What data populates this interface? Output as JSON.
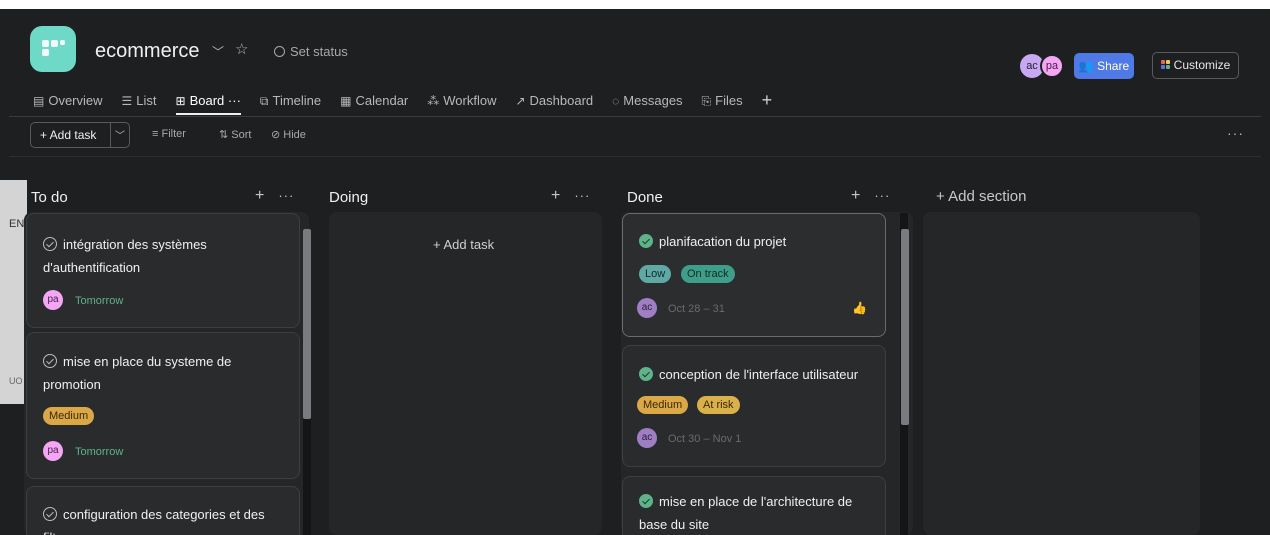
{
  "header": {
    "project_title": "ecommerce",
    "set_status": "Set status",
    "avatars": [
      "ac",
      "pa"
    ],
    "share_label": "Share",
    "customize_label": "Customize"
  },
  "tabs": [
    {
      "icon": "▤",
      "label": "Overview"
    },
    {
      "icon": "☰",
      "label": "List"
    },
    {
      "icon": "⊞",
      "label": "Board",
      "active": true,
      "extra": "···"
    },
    {
      "icon": "⧉",
      "label": "Timeline"
    },
    {
      "icon": "▦",
      "label": "Calendar"
    },
    {
      "icon": "⁂",
      "label": "Workflow"
    },
    {
      "icon": "↗",
      "label": "Dashboard"
    },
    {
      "icon": "◌",
      "label": "Messages"
    },
    {
      "icon": "⎘",
      "label": "Files"
    }
  ],
  "toolbar": {
    "add_task": "+ Add task",
    "filter": "Filter",
    "sort": "Sort",
    "hide": "Hide",
    "more": "···"
  },
  "left_strip": {
    "top_text": "EN",
    "bottom_text": "UO"
  },
  "columns": {
    "todo": {
      "title": "To do",
      "cards": [
        {
          "title": "intégration des systèmes d'authentification",
          "assignee": "pa",
          "due": "Tomorrow"
        },
        {
          "title": "mise en place du systeme de promotion",
          "priority": "Medium",
          "assignee": "pa",
          "due": "Tomorrow"
        },
        {
          "title": "configuration des categories et des filtres"
        }
      ]
    },
    "doing": {
      "title": "Doing",
      "add_task": "+ Add task"
    },
    "done": {
      "title": "Done",
      "cards": [
        {
          "title": "planifacation du projet",
          "priority": "Low",
          "status": "On track",
          "assignee": "ac",
          "due": "Oct 28 – 31"
        },
        {
          "title": "conception de l'interface utilisateur",
          "priority": "Medium",
          "status": "At risk",
          "assignee": "ac",
          "due": "Oct 30 – Nov 1"
        },
        {
          "title": "mise en place de l'architecture de base du site"
        }
      ]
    },
    "add_section": "+ Add section"
  },
  "colors": {
    "background": "#1e1f21",
    "card": "#2a2b2d",
    "share": "#4e79e6",
    "logo": "#6fd9c7",
    "due_green": "#5fb38a"
  }
}
